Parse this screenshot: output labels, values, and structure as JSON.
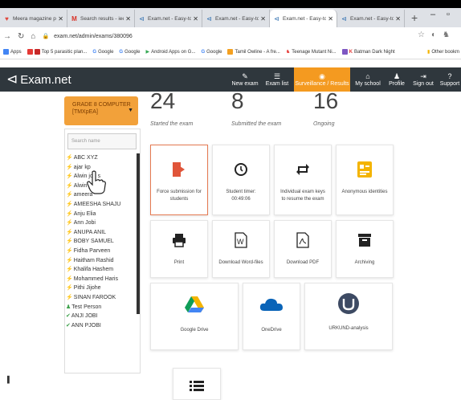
{
  "browser": {
    "tabs": [
      {
        "label": "Meera magazine proje",
        "icon_color": "#e0473b"
      },
      {
        "label": "Search results - ieennu",
        "icon_color": "#d93025"
      },
      {
        "label": "Exam.net - Easy-to-use",
        "icon_color": "#2f6fb0"
      },
      {
        "label": "Exam.net - Easy-to-use",
        "icon_color": "#2f6fb0"
      },
      {
        "label": "Exam.net - Easy-to-use",
        "icon_color": "#2f6fb0"
      },
      {
        "label": "Exam.net - Easy-to-use",
        "icon_color": "#2f6fb0"
      }
    ],
    "url": "exam.net/admin/exams/380096",
    "bookmarks": [
      "Apps",
      "Top 5 parasitic plan...",
      "Google",
      "Google",
      "Android Apps on G...",
      "Google",
      "Tamil Owline - A fre...",
      "Teenage Mutant Ni...",
      "Batman Dark Night"
    ],
    "other_bookmarks": "Other bookm"
  },
  "appbar": {
    "logo": "Exam.net",
    "nav": [
      {
        "label": "New exam",
        "icon": "pencil-icon"
      },
      {
        "label": "Exam list",
        "icon": "list-icon"
      },
      {
        "label": "Surveillance / Results",
        "icon": "eye-icon"
      },
      {
        "label": "My school",
        "icon": "home-icon"
      },
      {
        "label": "Profile",
        "icon": "person-icon"
      },
      {
        "label": "Sign out",
        "icon": "signout-icon"
      },
      {
        "label": "Support",
        "icon": "help-icon"
      }
    ]
  },
  "class_selector": {
    "line1": "GRADE 8 COMPUTER",
    "line2": "[TMXpEA]"
  },
  "search": {
    "placeholder": "Search name"
  },
  "students": [
    {
      "name": "ABC XYZ",
      "mark": "⚡"
    },
    {
      "name": "ajar kp",
      "mark": "⚡"
    },
    {
      "name": "Alwin joh  s",
      "mark": "⚡"
    },
    {
      "name": "Alwin j  es",
      "mark": "⚡"
    },
    {
      "name": "ameera",
      "mark": "⚡"
    },
    {
      "name": "AMEESHA SHAJU",
      "mark": "⚡"
    },
    {
      "name": "Anju Elia",
      "mark": "⚡"
    },
    {
      "name": "Ann Jobi",
      "mark": "⚡"
    },
    {
      "name": "ANUPA ANIL",
      "mark": "⚡"
    },
    {
      "name": "BOBY SAMUEL",
      "mark": "⚡"
    },
    {
      "name": "Fidha Parveen",
      "mark": "⚡"
    },
    {
      "name": "Haitham Rashid",
      "mark": "⚡"
    },
    {
      "name": "Khalifa Hashem",
      "mark": "⚡"
    },
    {
      "name": "Mohammed Haris",
      "mark": "⚡"
    },
    {
      "name": "Pithi Jijohe",
      "mark": "⚡"
    },
    {
      "name": "SINAN FAROOK",
      "mark": "⚡"
    },
    {
      "name": "Test Person",
      "mark": "♟"
    },
    {
      "name": "ANJI JOBI",
      "mark": "✔"
    },
    {
      "name": "ANN PJOBI",
      "mark": "✔"
    }
  ],
  "stats": [
    {
      "value": "24",
      "label": "Started the exam"
    },
    {
      "value": "8",
      "label": "Submitted the exam"
    },
    {
      "value": "16",
      "label": "Ongoing"
    }
  ],
  "tiles": [
    {
      "label": "Force submission for students",
      "icon": "force-submit-icon"
    },
    {
      "label": "Student timer: 00:49:06",
      "icon": "clock-icon"
    },
    {
      "label": "Individual exam keys to resume the exam",
      "icon": "keys-icon"
    },
    {
      "label": "Anonymous identities",
      "icon": "anonymous-icon"
    },
    {
      "label": "Print",
      "icon": "print-icon"
    },
    {
      "label": "Download Word-files",
      "icon": "word-icon"
    },
    {
      "label": "Download PDF",
      "icon": "pdf-icon"
    },
    {
      "label": "Archiving",
      "icon": "archive-icon"
    },
    {
      "label": "Google Drive",
      "icon": "google-drive-icon"
    },
    {
      "label": "OneDrive",
      "icon": "onedrive-icon"
    },
    {
      "label": "URKUND-analysis",
      "icon": "urkund-icon"
    },
    {
      "label": "",
      "icon": "list-icon"
    }
  ],
  "colors": {
    "accent": "#f49a20",
    "appbar": "#2f373d",
    "force_red": "#e0553a"
  }
}
